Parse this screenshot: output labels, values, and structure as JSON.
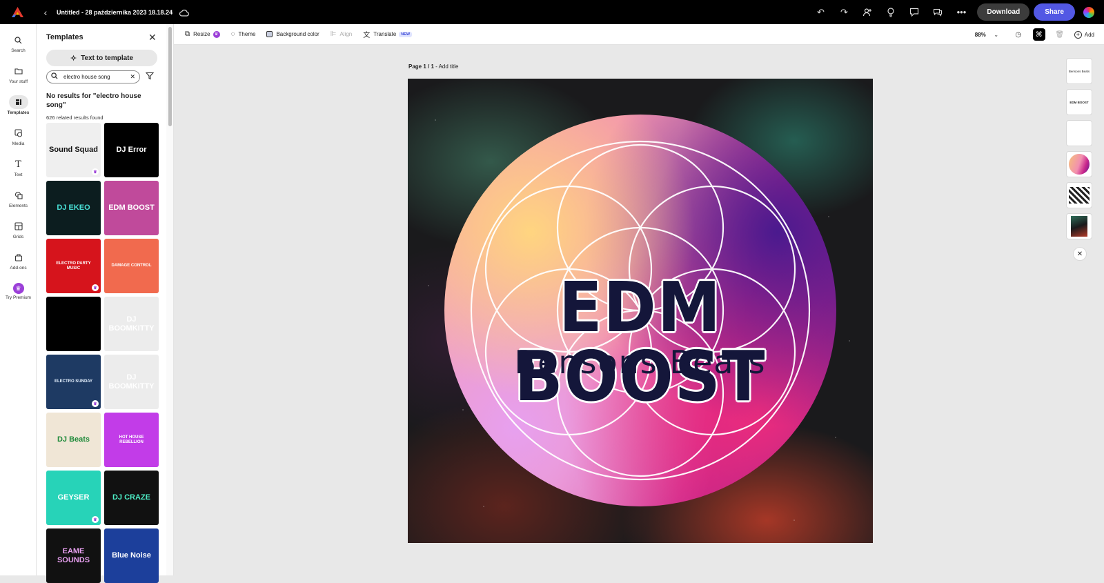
{
  "topbar": {
    "doc_title": "Untitled - 28 października 2023 18.18.24",
    "download_label": "Download",
    "share_label": "Share"
  },
  "rail": [
    {
      "label": "Search",
      "icon": "search-icon"
    },
    {
      "label": "Your stuff",
      "icon": "folder-icon"
    },
    {
      "label": "Templates",
      "icon": "templates-icon",
      "active": true
    },
    {
      "label": "Media",
      "icon": "media-icon"
    },
    {
      "label": "Text",
      "icon": "text-icon"
    },
    {
      "label": "Elements",
      "icon": "elements-icon"
    },
    {
      "label": "Grids",
      "icon": "grid-icon"
    },
    {
      "label": "Add-ons",
      "icon": "addons-icon"
    },
    {
      "label": "Try Premium",
      "icon": "crown-icon"
    }
  ],
  "panel": {
    "title": "Templates",
    "text_to_template": "Text to template",
    "search_value": "electro house song",
    "no_results": "No results for \"electro house song\"",
    "related_count": "626 related results found"
  },
  "templates": [
    {
      "text": "Sound Squad",
      "bg": "#efefef",
      "fg": "#111",
      "premium": true
    },
    {
      "text": "DJ Error",
      "bg": "#000000",
      "fg": "#fff",
      "premium": false
    },
    {
      "text": "DJ EKEO",
      "bg": "#0c1d1f",
      "fg": "#49e0d6",
      "premium": false
    },
    {
      "text": "EDM BOOST",
      "bg": "#c04a9b",
      "fg": "#fff",
      "premium": false
    },
    {
      "text": "ELECTRO PARTY MUSIC",
      "bg": "#d6141c",
      "fg": "#fff",
      "premium": true
    },
    {
      "text": "DAMAGE CONTROL",
      "bg": "#f16a4e",
      "fg": "#fff",
      "premium": false
    },
    {
      "text": "",
      "bg": "#000000",
      "fg": "#fff",
      "premium": false
    },
    {
      "text": "DJ BOOMKITTY",
      "bg": "#ececec",
      "fg": "#fff",
      "premium": false
    },
    {
      "text": "ELECTRO SUNDAY",
      "bg": "#1e3a63",
      "fg": "#e6f2ff",
      "premium": true
    },
    {
      "text": "DJ BOOMKITTY",
      "bg": "#ececec",
      "fg": "#fff",
      "premium": false
    },
    {
      "text": "DJ Beats",
      "bg": "#f0e6d6",
      "fg": "#1f8a3a",
      "premium": false
    },
    {
      "text": "HOT HOUSE REBELLION",
      "bg": "#c23ce8",
      "fg": "#fff",
      "premium": false
    },
    {
      "text": "GEYSER",
      "bg": "#27d3b8",
      "fg": "#fff",
      "premium": true
    },
    {
      "text": "DJ CRAZE",
      "bg": "#111111",
      "fg": "#4ef0c8",
      "premium": false
    },
    {
      "text": "EAME SOUNDS",
      "bg": "#111111",
      "fg": "#e7a0ef",
      "premium": false
    },
    {
      "text": "Blue Noise",
      "bg": "#1c3f9b",
      "fg": "#fff",
      "premium": false
    }
  ],
  "toolbar": {
    "resize": "Resize",
    "theme": "Theme",
    "background_color": "Background color",
    "align": "Align",
    "translate": "Translate",
    "new_badge": "NEW",
    "zoom": "88%",
    "add": "Add"
  },
  "page": {
    "label_prefix": "Page 1 / 1",
    "add_title": " - Add title"
  },
  "design": {
    "title": "EDM BOOST",
    "subtitle": "Bensons Beats"
  },
  "page_layers": [
    {
      "label": "Bensons Beats"
    },
    {
      "label": "EDM BOOST"
    },
    {
      "label": ""
    },
    {
      "label": ""
    },
    {
      "label": ""
    },
    {
      "label": ""
    }
  ]
}
